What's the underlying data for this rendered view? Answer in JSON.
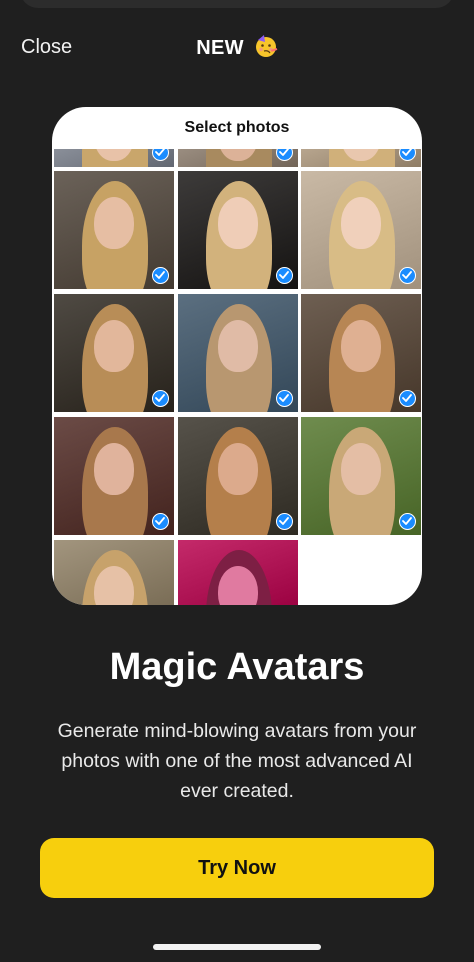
{
  "header": {
    "close_label": "Close",
    "title": "NEW",
    "title_emoji": "partying-face-emoji"
  },
  "card": {
    "title": "Select photos",
    "photos": [
      {
        "selected": true,
        "bg": "#8a8f99",
        "hair": "#c9a66b",
        "skin": "#e8c2a8"
      },
      {
        "selected": true,
        "bg": "#9a8d80",
        "hair": "#a88a5f",
        "skin": "#dcb298"
      },
      {
        "selected": true,
        "bg": "#b7a58e",
        "hair": "#d0b07a",
        "skin": "#e9c7ae"
      },
      {
        "selected": true,
        "bg": "#6b6259",
        "hair": "#c7a264",
        "skin": "#e6bea3"
      },
      {
        "selected": true,
        "bg": "#3d3b3a",
        "hair": "#d2b27c",
        "skin": "#efcdb7"
      },
      {
        "selected": true,
        "bg": "#c9b9a5",
        "hair": "#d8bc86",
        "skin": "#f0d0bb"
      },
      {
        "selected": true,
        "bg": "#4f4a43",
        "hair": "#b88d57",
        "skin": "#e2b79b"
      },
      {
        "selected": true,
        "bg": "#5b6f80",
        "hair": "#b89770",
        "skin": "#e0bba6"
      },
      {
        "selected": true,
        "bg": "#6e5f52",
        "hair": "#b78654",
        "skin": "#dfb092"
      },
      {
        "selected": true,
        "bg": "#6b4b46",
        "hair": "#a8784c",
        "skin": "#e0b39c"
      },
      {
        "selected": true,
        "bg": "#56524a",
        "hair": "#b47f4b",
        "skin": "#dcaa8c"
      },
      {
        "selected": true,
        "bg": "#6f8c4e",
        "hair": "#c9a877",
        "skin": "#e4bea5"
      },
      {
        "selected": false,
        "bg": "#a2957e",
        "hair": "#c7a26b",
        "skin": "#e6c1a6"
      },
      {
        "selected": false,
        "bg": "#c42a6a",
        "hair": "#7d1f44",
        "skin": "#e07aa0"
      }
    ]
  },
  "main": {
    "headline": "Magic Avatars",
    "description": "Generate mind-blowing avatars from your photos with one of the most advanced AI ever created.",
    "cta_label": "Try Now"
  },
  "colors": {
    "background": "#1f1f1f",
    "accent": "#f7cf0d",
    "check": "#1a8cff"
  }
}
